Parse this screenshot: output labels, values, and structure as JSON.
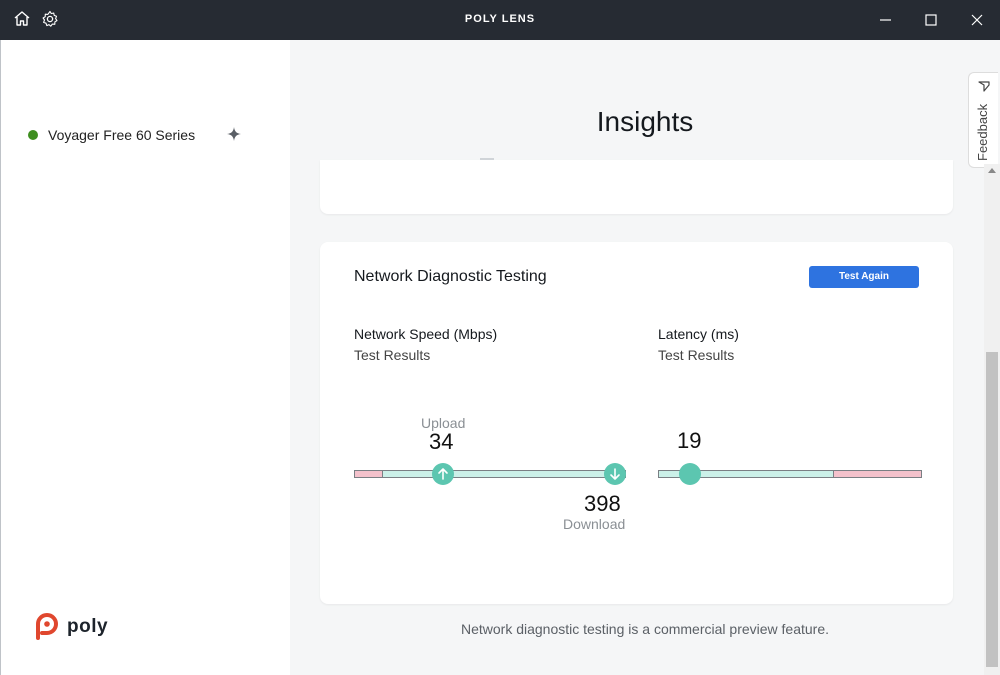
{
  "window": {
    "title": "POLY LENS"
  },
  "titlebar_icons": [
    "home-icon",
    "gear-icon"
  ],
  "window_controls": [
    "minimize-icon",
    "maximize-icon",
    "close-icon"
  ],
  "sidebar": {
    "device": {
      "name": "Voyager Free 60 Series",
      "status_color": "#3e8e1f"
    },
    "logo": {
      "wordmark": "poly"
    }
  },
  "main": {
    "title": "Insights",
    "network_card": {
      "title": "Network Diagnostic Testing",
      "button_label": "Test Again",
      "speed": {
        "label": "Network Speed (Mbps)",
        "sub": "Test Results",
        "upload_label": "Upload",
        "upload_value": "34",
        "download_label": "Download",
        "download_value": "398"
      },
      "latency": {
        "label": "Latency (ms)",
        "sub": "Test Results",
        "value": "19"
      }
    },
    "footnote": "Network diagnostic testing is a commercial preview feature."
  },
  "feedback": {
    "label": "Feedback"
  },
  "colors": {
    "accent": "#2e73e0",
    "gauge_fill": "#cbf0e8",
    "gauge_warn": "#f4c2cc",
    "knob": "#5cc6b0"
  }
}
